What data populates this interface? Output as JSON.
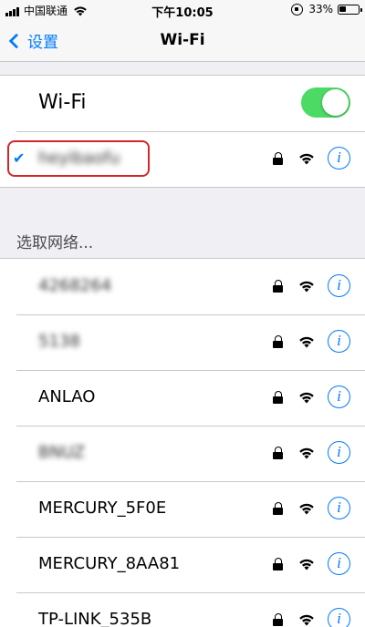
{
  "status_bar": {
    "carrier": "中国联通",
    "time": "下午10:05",
    "battery": "33%",
    "battery_level": 0.33
  },
  "nav": {
    "back_label": "设置",
    "title": "Wi-Fi"
  },
  "wifi_toggle": {
    "label": "Wi-Fi",
    "on": true,
    "on_color": "#4cd964"
  },
  "connected": {
    "ssid": "heyibaofu",
    "checkmark": "✔",
    "highlight_color": "#d6252a"
  },
  "networks_header": "选取网络...",
  "networks": [
    {
      "ssid": "4268264",
      "blurred": true
    },
    {
      "ssid": "5138",
      "blurred": true
    },
    {
      "ssid": "ANLAO",
      "blurred": false
    },
    {
      "ssid": "BNUZ",
      "blurred": true
    },
    {
      "ssid": "MERCURY_5F0E",
      "blurred": false
    },
    {
      "ssid": "MERCURY_8AA81",
      "blurred": false
    },
    {
      "ssid": "TP-LINK_535B",
      "blurred": false
    }
  ],
  "info_glyph": "i",
  "accent_color": "#007aff",
  "icons": [
    "signal-icon",
    "wifi-icon",
    "rotation-lock-icon",
    "battery-icon",
    "back-chevron-icon",
    "checkmark-icon",
    "lock-icon",
    "info-icon"
  ]
}
